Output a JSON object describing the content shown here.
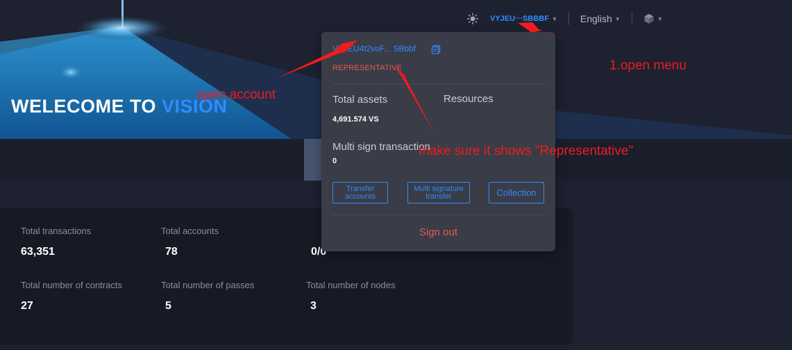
{
  "header": {
    "address_short": "VYJEU···SBBBF",
    "language": "English"
  },
  "banner": {
    "welcome_prefix": "WELECOME TO ",
    "welcome_accent": "VISION"
  },
  "stats": [
    {
      "label": "Total transactions",
      "value": "63,351"
    },
    {
      "label": "Total accounts",
      "value": "78"
    },
    {
      "label": "",
      "value": "0/0"
    },
    {
      "label": "Total number of contracts",
      "value": "27"
    },
    {
      "label": "Total number of passes",
      "value": "5"
    },
    {
      "label": "Total number of nodes",
      "value": "3"
    }
  ],
  "dropdown": {
    "address": "VYJEU4t2voF... SBbbf",
    "role": "REPRESENTATIVE",
    "total_assets_label": "Total assets",
    "total_assets_value": "4,691.574 VS",
    "resources_label": "Resources",
    "multisign_label": "Multi sign transaction",
    "multisign_value": "0",
    "buttons": {
      "transfer_accounts": "Transfer accounts",
      "multi_signature_transfer": "Multi signature transfer",
      "collection": "Collection"
    },
    "sign_out": "Sign out"
  },
  "annotations": {
    "open_menu": "1.open menu",
    "open_account": "open account",
    "representative_note": "make sure it shows \"Representative\""
  },
  "colors": {
    "accent_blue": "#2f8cff",
    "role_red": "#e35d4f",
    "annotation_red": "#ef1c1c",
    "page_bg": "#1d2130",
    "dropdown_bg": "#3a3c47"
  }
}
